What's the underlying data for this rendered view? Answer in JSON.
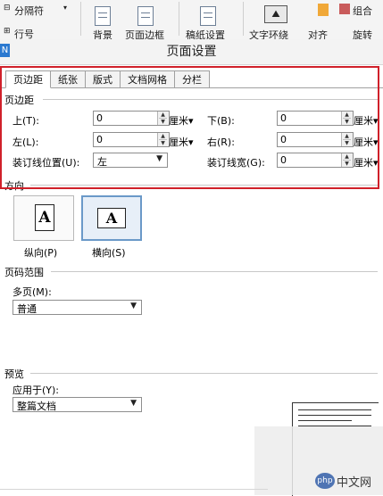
{
  "ribbon": {
    "page_break": "分隔符",
    "line_num": "行号",
    "background": "背景",
    "page_border": "页面边框",
    "paper_setup": "稿纸设置",
    "text_wrap": "文字环绕",
    "align": "对齐",
    "rotate": "旋转",
    "group": "组合"
  },
  "dialog": {
    "title": "页面设置",
    "tabs": [
      "页边距",
      "纸张",
      "版式",
      "文档网格",
      "分栏"
    ]
  },
  "margins": {
    "section": "页边距",
    "top_label": "上(T):",
    "top_value": "0",
    "bottom_label": "下(B):",
    "bottom_value": "0",
    "left_label": "左(L):",
    "left_value": "0",
    "right_label": "右(R):",
    "right_value": "0",
    "unit": "厘米",
    "gutter_pos_label": "装订线位置(U):",
    "gutter_pos_value": "左",
    "gutter_width_label": "装订线宽(G):",
    "gutter_width_value": "0"
  },
  "orientation": {
    "section": "方向",
    "portrait": "纵向(P)",
    "landscape": "横向(S)",
    "icon_letter": "A",
    "selected": "landscape"
  },
  "page_range": {
    "section": "页码范围",
    "multi_label": "多页(M):",
    "multi_value": "普通"
  },
  "preview": {
    "section": "预览",
    "apply_label": "应用于(Y):",
    "apply_value": "整篇文档"
  },
  "watermark": {
    "logo": "php",
    "text": "中文网"
  },
  "colors": {
    "highlight": "#d0202a",
    "selected_border": "#6a99c8",
    "app_badge": "#2b79d0"
  }
}
